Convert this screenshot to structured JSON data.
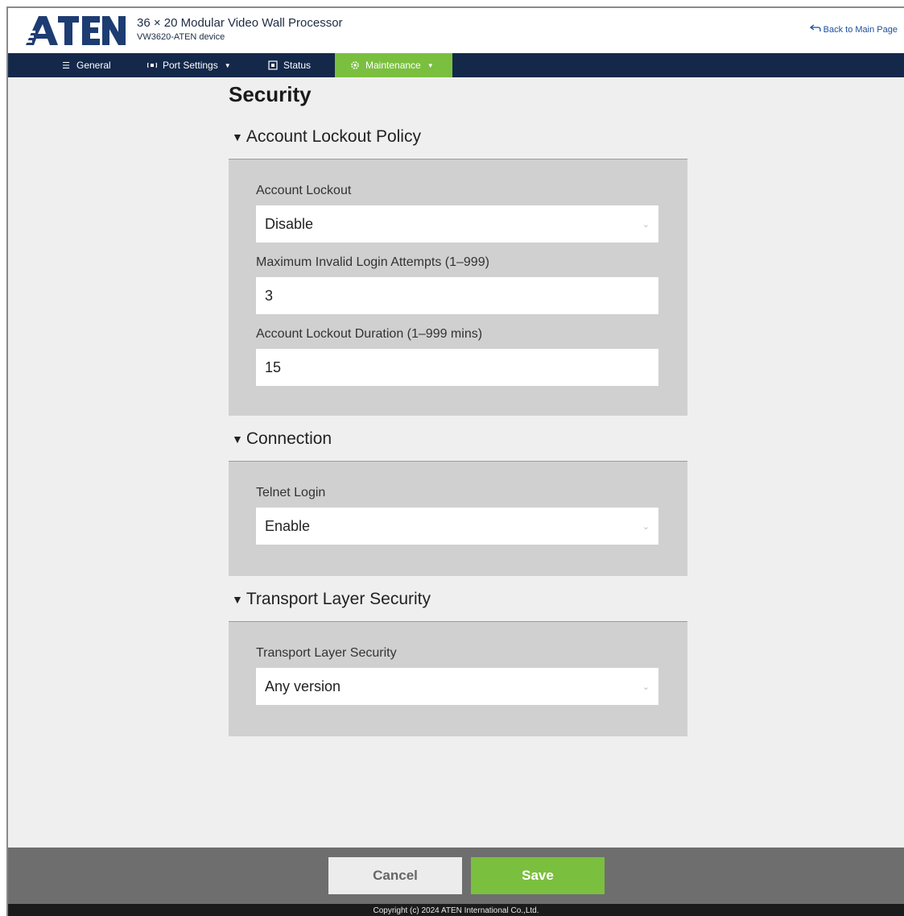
{
  "header": {
    "logo_text": "ATEN",
    "title": "36 × 20 Modular Video Wall Processor",
    "subtitle": "VW3620-ATEN device",
    "back_link": "Back to Main Page",
    "back_icon": "return-arrow-icon"
  },
  "nav": {
    "items": [
      {
        "label": "General",
        "icon": "list-icon",
        "active": false
      },
      {
        "label": "Port Settings",
        "icon": "port-icon",
        "active": false,
        "dropdown": true
      },
      {
        "label": "Status",
        "icon": "status-icon",
        "active": false
      },
      {
        "label": "Maintenance",
        "icon": "gear-icon",
        "active": true,
        "dropdown": true
      }
    ]
  },
  "page": {
    "title": "Security"
  },
  "sections": {
    "lockout": {
      "title": "Account Lockout Policy",
      "fields": [
        {
          "label": "Account Lockout",
          "value": "Disable",
          "type": "select"
        },
        {
          "label": "Maximum Invalid Login Attempts (1–999)",
          "value": "3",
          "type": "input"
        },
        {
          "label": "Account Lockout Duration (1–999 mins)",
          "value": "15",
          "type": "input"
        }
      ]
    },
    "connection": {
      "title": "Connection",
      "fields": [
        {
          "label": "Telnet Login",
          "value": "Enable",
          "type": "select"
        }
      ]
    },
    "tls": {
      "title": "Transport Layer Security",
      "fields": [
        {
          "label": "Transport Layer Security",
          "value": "Any version",
          "type": "select"
        }
      ]
    }
  },
  "actions": {
    "cancel": "Cancel",
    "save": "Save"
  },
  "footer": {
    "copyright": "Copyright (c) 2024 ATEN International Co.,Ltd."
  },
  "colors": {
    "nav_bg": "#14284a",
    "accent_green": "#7bbf3f",
    "panel_bg": "#d0d0d0",
    "action_bar_bg": "#6e6e6e"
  }
}
